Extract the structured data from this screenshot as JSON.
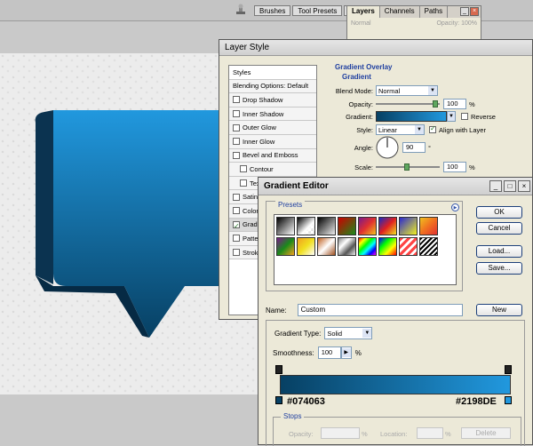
{
  "palette_tabs": [
    "Brushes",
    "Tool Presets",
    "..."
  ],
  "layers_palette": {
    "tabs": [
      "Layers",
      "Channels",
      "Paths"
    ],
    "blend": "Normal",
    "opacity_label": "Opacity:",
    "opacity_value": "100%"
  },
  "layer_style": {
    "title": "Layer Style",
    "styles_header": "Styles",
    "items": [
      {
        "label": "Blending Options: Default",
        "checkbox": false,
        "checked": false,
        "indent": false,
        "selected": false
      },
      {
        "label": "Drop Shadow",
        "checkbox": true,
        "checked": false,
        "indent": false,
        "selected": false
      },
      {
        "label": "Inner Shadow",
        "checkbox": true,
        "checked": false,
        "indent": false,
        "selected": false
      },
      {
        "label": "Outer Glow",
        "checkbox": true,
        "checked": false,
        "indent": false,
        "selected": false
      },
      {
        "label": "Inner Glow",
        "checkbox": true,
        "checked": false,
        "indent": false,
        "selected": false
      },
      {
        "label": "Bevel and Emboss",
        "checkbox": true,
        "checked": false,
        "indent": false,
        "selected": false
      },
      {
        "label": "Contour",
        "checkbox": true,
        "checked": false,
        "indent": true,
        "selected": false
      },
      {
        "label": "Tex",
        "checkbox": true,
        "checked": false,
        "indent": true,
        "selected": false
      },
      {
        "label": "Satin",
        "checkbox": true,
        "checked": false,
        "indent": false,
        "selected": false
      },
      {
        "label": "Color",
        "checkbox": true,
        "checked": false,
        "indent": false,
        "selected": false
      },
      {
        "label": "Gradi",
        "checkbox": true,
        "checked": true,
        "indent": false,
        "selected": true
      },
      {
        "label": "Patte",
        "checkbox": true,
        "checked": false,
        "indent": false,
        "selected": false
      },
      {
        "label": "Stroke",
        "checkbox": true,
        "checked": false,
        "indent": false,
        "selected": false
      }
    ],
    "group_title": "Gradient Overlay",
    "group_sub": "Gradient",
    "blend_mode_label": "Blend Mode:",
    "blend_mode_value": "Normal",
    "opacity_label": "Opacity:",
    "opacity_value": "100",
    "opacity_pct": 1.0,
    "gradient_label": "Gradient:",
    "reverse_label": "Reverse",
    "style_label": "Style:",
    "style_value": "Linear",
    "align_label": "Align with Layer",
    "angle_label": "Angle:",
    "angle_value": "90",
    "angle_unit": "°",
    "scale_label": "Scale:",
    "scale_value": "100",
    "scale_pct": 0.5,
    "pct_unit": "%"
  },
  "gradient_editor": {
    "title": "Gradient Editor",
    "presets_label": "Presets",
    "ok_label": "OK",
    "cancel_label": "Cancel",
    "load_label": "Load...",
    "save_label": "Save...",
    "name_label": "Name:",
    "name_value": "Custom",
    "new_label": "New",
    "type_label": "Gradient Type:",
    "type_value": "Solid",
    "smooth_label": "Smoothness:",
    "smooth_value": "100",
    "smooth_unit": "%",
    "color_left": "#074063",
    "color_right": "#2198DE",
    "stops_label": "Stops",
    "stop_opacity_label": "Opacity:",
    "stop_location_label": "Location:",
    "pct": "%",
    "delete_label": "Delete"
  },
  "colors": {
    "bubble_top": "#2198DE",
    "bubble_bottom": "#074063",
    "accent_blue": "#1f3fa0"
  }
}
